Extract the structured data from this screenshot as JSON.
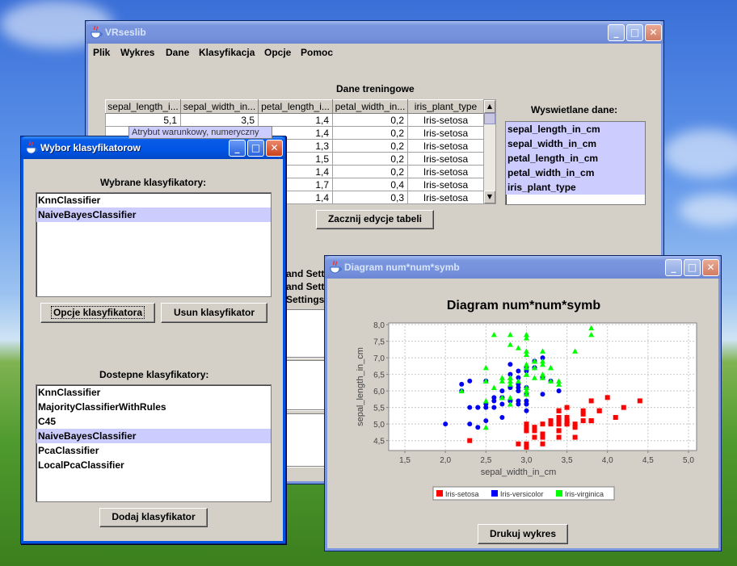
{
  "main_window": {
    "title": "VRseslib",
    "menu": [
      "Plik",
      "Wykres",
      "Dane",
      "Klasyfikacja",
      "Opcje",
      "Pomoc"
    ],
    "training_title": "Dane treningowe",
    "columns": [
      "sepal_length_i...",
      "sepal_width_in...",
      "petal_length_i...",
      "petal_width_in...",
      "iris_plant_type"
    ],
    "rows": [
      [
        "5,1",
        "3,5",
        "1,4",
        "0,2",
        "Iris-setosa"
      ],
      [
        "",
        "",
        "1,4",
        "0,2",
        "Iris-setosa"
      ],
      [
        "",
        "",
        "1,3",
        "0,2",
        "Iris-setosa"
      ],
      [
        "",
        "",
        "1,5",
        "0,2",
        "Iris-setosa"
      ],
      [
        "",
        "",
        "1,4",
        "0,2",
        "Iris-setosa"
      ],
      [
        "",
        "",
        "1,7",
        "0,4",
        "Iris-setosa"
      ],
      [
        "",
        "",
        "1,4",
        "0,3",
        "Iris-setosa"
      ]
    ],
    "tooltip": "Atrybut warunkowy, numeryczny",
    "displayed_title": "Wyswietlane dane:",
    "displayed_items": [
      "sepal_length_in_cm",
      "sepal_width_in_cm",
      "petal_length_in_cm",
      "petal_width_in_cm",
      "iris_plant_type"
    ],
    "edit_button": "Zacznij edycje tabeli",
    "settings_labels": [
      "and Setti",
      "and Settin",
      "Settings"
    ]
  },
  "classifier_window": {
    "title": "Wybor klasyfikatorow",
    "selected_title": "Wybrane klasyfikatory:",
    "selected_items": [
      "KnnClassifier",
      "NaiveBayesClassifier"
    ],
    "options_button": "Opcje klasyfikatora",
    "remove_button": "Usun klasyfikator",
    "available_title": "Dostepne klasyfikatory:",
    "available_items": [
      "KnnClassifier",
      "MajorityClassifierWithRules",
      "C45",
      "NaiveBayesClassifier",
      "PcaClassifier",
      "LocalPcaClassifier"
    ],
    "add_button": "Dodaj klasyfikator"
  },
  "chart_window": {
    "title": "Diagram num*num*symb",
    "print_button": "Drukuj wykres"
  },
  "colors": {
    "setosa": "#ff0000",
    "versicolor": "#0000ff",
    "virginica": "#00ff00",
    "selection": "#ccccff"
  },
  "chart_data": {
    "type": "scatter",
    "title": "Diagram num*num*symb",
    "xlabel": "sepal_width_in_cm",
    "ylabel": "sepal_length_in_cm",
    "xlim": [
      1.3,
      5.1
    ],
    "ylim": [
      4.2,
      8.05
    ],
    "xticks": [
      "1,5",
      "2,0",
      "2,5",
      "3,0",
      "3,5",
      "4,0",
      "4,5",
      "5,0"
    ],
    "yticks": [
      "4,5",
      "5,0",
      "5,5",
      "6,0",
      "6,5",
      "7,0",
      "7,5",
      "8,0"
    ],
    "grid": true,
    "legend": "bottom",
    "series": [
      {
        "name": "Iris-setosa",
        "marker": "square",
        "points": [
          [
            3.5,
            5.1
          ],
          [
            3.0,
            4.9
          ],
          [
            3.2,
            4.7
          ],
          [
            3.1,
            4.6
          ],
          [
            3.6,
            5.0
          ],
          [
            3.9,
            5.4
          ],
          [
            3.4,
            4.6
          ],
          [
            3.4,
            5.0
          ],
          [
            2.9,
            4.4
          ],
          [
            3.1,
            4.9
          ],
          [
            3.7,
            5.4
          ],
          [
            3.4,
            4.8
          ],
          [
            3.0,
            4.8
          ],
          [
            3.0,
            4.3
          ],
          [
            4.0,
            5.8
          ],
          [
            4.4,
            5.7
          ],
          [
            3.9,
            5.4
          ],
          [
            3.5,
            5.1
          ],
          [
            3.8,
            5.7
          ],
          [
            3.8,
            5.1
          ],
          [
            3.4,
            5.4
          ],
          [
            3.7,
            5.1
          ],
          [
            3.6,
            4.6
          ],
          [
            3.3,
            5.1
          ],
          [
            3.4,
            4.8
          ],
          [
            3.0,
            5.0
          ],
          [
            3.4,
            5.0
          ],
          [
            3.5,
            5.2
          ],
          [
            3.4,
            5.2
          ],
          [
            3.2,
            4.7
          ],
          [
            3.1,
            4.8
          ],
          [
            3.4,
            5.4
          ],
          [
            4.1,
            5.2
          ],
          [
            4.2,
            5.5
          ],
          [
            3.1,
            4.9
          ],
          [
            3.2,
            5.0
          ],
          [
            3.5,
            5.5
          ],
          [
            3.6,
            4.9
          ],
          [
            3.0,
            4.4
          ],
          [
            3.4,
            5.1
          ],
          [
            3.5,
            5.0
          ],
          [
            2.3,
            4.5
          ],
          [
            3.2,
            4.4
          ],
          [
            3.5,
            5.0
          ],
          [
            3.8,
            5.1
          ],
          [
            3.0,
            4.8
          ],
          [
            3.8,
            5.1
          ],
          [
            3.2,
            4.6
          ],
          [
            3.7,
            5.3
          ],
          [
            3.3,
            5.0
          ]
        ]
      },
      {
        "name": "Iris-versicolor",
        "marker": "circle",
        "points": [
          [
            3.2,
            7.0
          ],
          [
            3.2,
            6.4
          ],
          [
            3.1,
            6.9
          ],
          [
            2.3,
            5.5
          ],
          [
            2.8,
            6.5
          ],
          [
            2.8,
            5.7
          ],
          [
            3.3,
            6.3
          ],
          [
            2.4,
            4.9
          ],
          [
            2.9,
            6.6
          ],
          [
            2.7,
            5.2
          ],
          [
            2.0,
            5.0
          ],
          [
            3.0,
            5.9
          ],
          [
            2.2,
            6.0
          ],
          [
            2.9,
            6.1
          ],
          [
            2.9,
            5.6
          ],
          [
            3.1,
            6.7
          ],
          [
            3.0,
            5.6
          ],
          [
            2.7,
            5.8
          ],
          [
            2.2,
            6.2
          ],
          [
            2.5,
            5.6
          ],
          [
            3.2,
            5.9
          ],
          [
            2.8,
            6.1
          ],
          [
            2.5,
            6.3
          ],
          [
            2.8,
            6.1
          ],
          [
            2.9,
            6.4
          ],
          [
            3.0,
            6.6
          ],
          [
            2.8,
            6.8
          ],
          [
            3.0,
            6.7
          ],
          [
            2.9,
            6.0
          ],
          [
            2.6,
            5.7
          ],
          [
            2.4,
            5.5
          ],
          [
            2.4,
            5.5
          ],
          [
            2.7,
            5.8
          ],
          [
            2.7,
            6.0
          ],
          [
            3.0,
            5.4
          ],
          [
            3.4,
            6.0
          ],
          [
            3.1,
            6.7
          ],
          [
            2.3,
            6.3
          ],
          [
            3.0,
            5.6
          ],
          [
            2.5,
            5.5
          ],
          [
            2.6,
            5.5
          ],
          [
            3.0,
            6.1
          ],
          [
            2.6,
            5.8
          ],
          [
            2.3,
            5.0
          ],
          [
            2.7,
            5.6
          ],
          [
            3.0,
            5.7
          ],
          [
            2.9,
            5.7
          ],
          [
            2.9,
            6.2
          ],
          [
            2.5,
            5.1
          ],
          [
            2.8,
            5.7
          ]
        ]
      },
      {
        "name": "Iris-virginica",
        "marker": "triangle",
        "points": [
          [
            3.3,
            6.3
          ],
          [
            2.7,
            5.8
          ],
          [
            3.0,
            7.1
          ],
          [
            2.9,
            6.3
          ],
          [
            3.0,
            6.5
          ],
          [
            3.0,
            7.6
          ],
          [
            2.5,
            4.9
          ],
          [
            2.9,
            7.3
          ],
          [
            2.5,
            6.7
          ],
          [
            3.6,
            7.2
          ],
          [
            3.2,
            6.5
          ],
          [
            2.7,
            6.4
          ],
          [
            3.0,
            6.8
          ],
          [
            2.5,
            5.7
          ],
          [
            2.8,
            5.8
          ],
          [
            3.2,
            6.4
          ],
          [
            3.0,
            6.5
          ],
          [
            3.8,
            7.7
          ],
          [
            2.6,
            7.7
          ],
          [
            2.2,
            6.0
          ],
          [
            3.2,
            6.9
          ],
          [
            2.8,
            5.6
          ],
          [
            2.8,
            7.7
          ],
          [
            2.7,
            6.3
          ],
          [
            3.3,
            6.7
          ],
          [
            3.2,
            7.2
          ],
          [
            2.8,
            6.2
          ],
          [
            3.0,
            6.1
          ],
          [
            2.8,
            6.4
          ],
          [
            3.0,
            7.2
          ],
          [
            2.8,
            7.4
          ],
          [
            3.8,
            7.9
          ],
          [
            2.8,
            6.4
          ],
          [
            2.8,
            6.3
          ],
          [
            2.6,
            6.1
          ],
          [
            3.0,
            7.7
          ],
          [
            3.4,
            6.3
          ],
          [
            3.1,
            6.4
          ],
          [
            3.0,
            6.0
          ],
          [
            3.1,
            6.9
          ],
          [
            3.1,
            6.7
          ],
          [
            3.1,
            6.9
          ],
          [
            2.7,
            5.8
          ],
          [
            3.2,
            6.8
          ],
          [
            3.3,
            6.7
          ],
          [
            3.0,
            6.7
          ],
          [
            2.5,
            6.3
          ],
          [
            3.0,
            6.5
          ],
          [
            3.4,
            6.2
          ],
          [
            3.0,
            5.9
          ]
        ]
      }
    ]
  }
}
